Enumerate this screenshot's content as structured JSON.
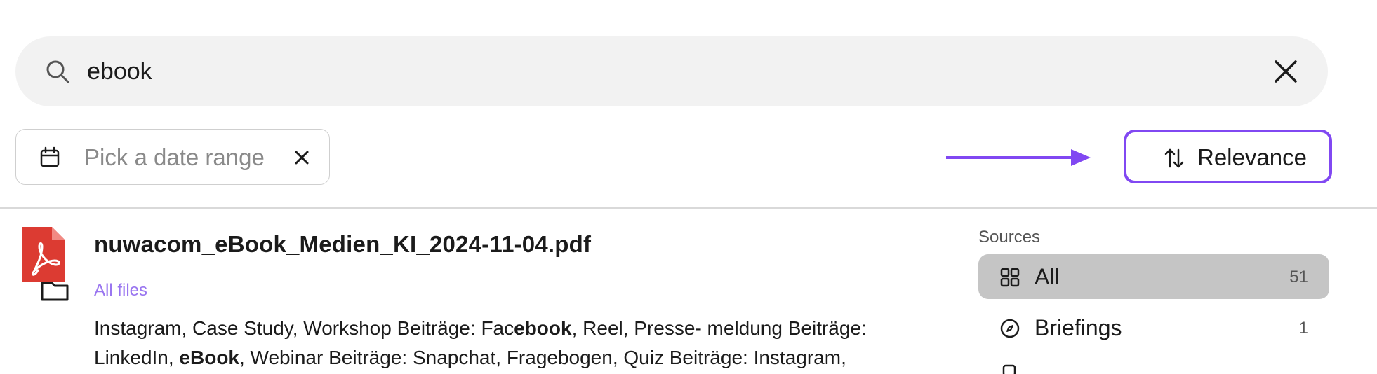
{
  "search": {
    "value": "ebook"
  },
  "filters": {
    "date_placeholder": "Pick a date range"
  },
  "sort": {
    "label": "Relevance"
  },
  "colors": {
    "accent": "#8148f2",
    "pdf_red": "#dc3b32",
    "source_link": "#9a76f0",
    "active_bg": "#c5c5c5"
  },
  "result": {
    "title": "nuwacom_eBook_Medien_KI_2024-11-04.pdf",
    "source": "All files",
    "snippet": {
      "line1_a": "Instagram, Case Study, Workshop Beiträge: Fac",
      "line1_b": "ebook",
      "line1_c": ", Reel, Presse- meldung Beiträge:",
      "line2_a": "LinkedIn, ",
      "line2_b": "eBook",
      "line2_c": ", Webinar Beiträge: Snapchat, Fragebogen, Quiz Beiträge: Instagram,"
    }
  },
  "sources": {
    "heading": "Sources",
    "items": [
      {
        "label": "All",
        "count": "51",
        "icon": "grid-icon"
      },
      {
        "label": "Briefings",
        "count": "1",
        "icon": "compass-icon"
      }
    ]
  }
}
